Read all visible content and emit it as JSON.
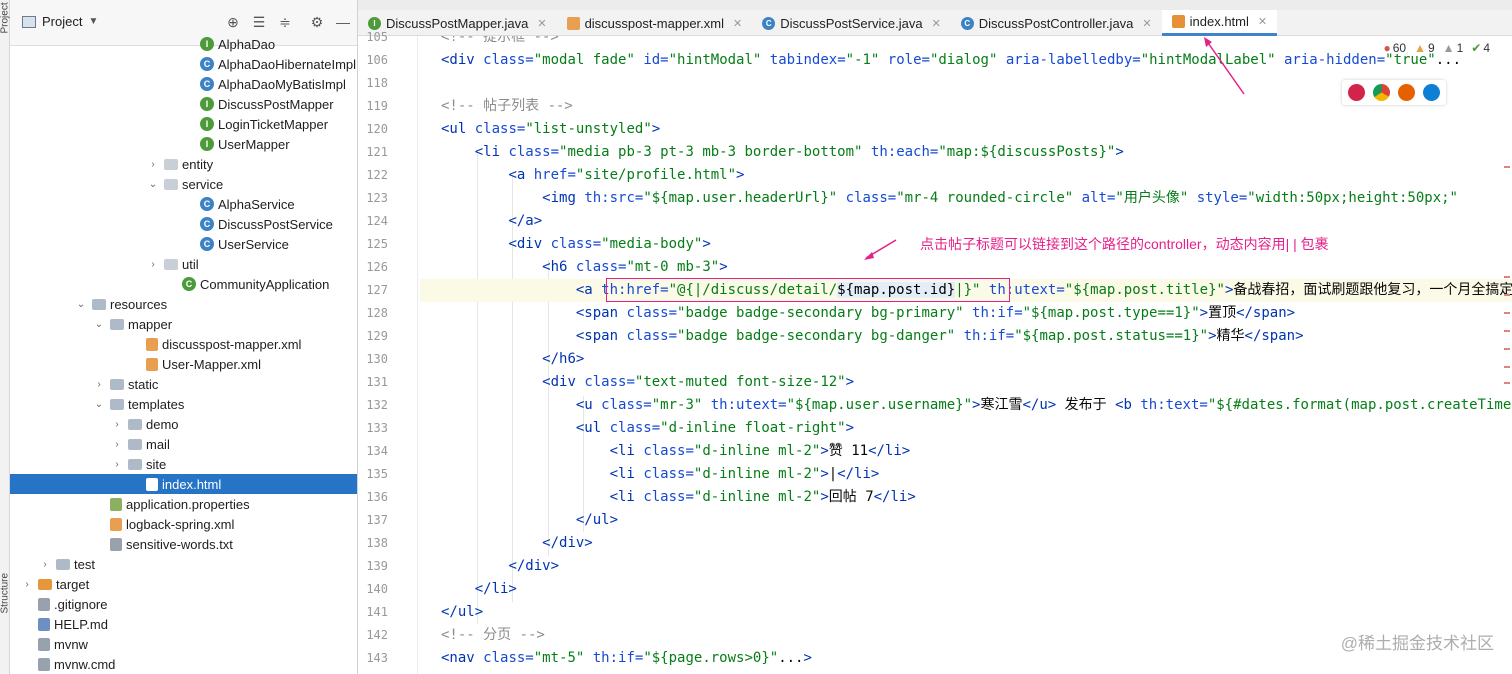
{
  "sidebar": {
    "strip_top": "Project",
    "strip_bottom": "Structure",
    "title": "Project",
    "icons": [
      "crosshair-icon",
      "expand-all-icon",
      "collapse-all-icon",
      "gear-icon",
      "minimize-icon"
    ]
  },
  "tree": [
    {
      "label": "AlphaDao",
      "depth": 10,
      "icon": "i",
      "arrow": ""
    },
    {
      "label": "AlphaDaoHibernateImpl",
      "depth": 10,
      "icon": "c",
      "arrow": ""
    },
    {
      "label": "AlphaDaoMyBatisImpl",
      "depth": 10,
      "icon": "c",
      "arrow": ""
    },
    {
      "label": "DiscussPostMapper",
      "depth": 10,
      "icon": "i",
      "arrow": ""
    },
    {
      "label": "LoginTicketMapper",
      "depth": 10,
      "icon": "i",
      "arrow": ""
    },
    {
      "label": "UserMapper",
      "depth": 10,
      "icon": "i",
      "arrow": ""
    },
    {
      "label": "entity",
      "depth": 8,
      "icon": "pkg",
      "arrow": "›"
    },
    {
      "label": "service",
      "depth": 8,
      "icon": "pkg",
      "arrow": "⌄"
    },
    {
      "label": "AlphaService",
      "depth": 10,
      "icon": "c",
      "arrow": ""
    },
    {
      "label": "DiscussPostService",
      "depth": 10,
      "icon": "c",
      "arrow": ""
    },
    {
      "label": "UserService",
      "depth": 10,
      "icon": "c",
      "arrow": ""
    },
    {
      "label": "util",
      "depth": 8,
      "icon": "pkg",
      "arrow": "›"
    },
    {
      "label": "CommunityApplication",
      "depth": 9,
      "icon": "sb",
      "arrow": ""
    },
    {
      "label": "resources",
      "depth": 4,
      "icon": "folder",
      "arrow": "⌄"
    },
    {
      "label": "mapper",
      "depth": 5,
      "icon": "folder",
      "arrow": "⌄"
    },
    {
      "label": "discusspost-mapper.xml",
      "depth": 7,
      "icon": "xml",
      "arrow": ""
    },
    {
      "label": "User-Mapper.xml",
      "depth": 7,
      "icon": "xml",
      "arrow": ""
    },
    {
      "label": "static",
      "depth": 5,
      "icon": "folder",
      "arrow": "›"
    },
    {
      "label": "templates",
      "depth": 5,
      "icon": "folder",
      "arrow": "⌄"
    },
    {
      "label": "demo",
      "depth": 6,
      "icon": "folder",
      "arrow": "›"
    },
    {
      "label": "mail",
      "depth": 6,
      "icon": "folder",
      "arrow": "›"
    },
    {
      "label": "site",
      "depth": 6,
      "icon": "folder",
      "arrow": "›"
    },
    {
      "label": "index.html",
      "depth": 7,
      "icon": "html",
      "arrow": "",
      "selected": true
    },
    {
      "label": "application.properties",
      "depth": 5,
      "icon": "prop",
      "arrow": ""
    },
    {
      "label": "logback-spring.xml",
      "depth": 5,
      "icon": "xml",
      "arrow": ""
    },
    {
      "label": "sensitive-words.txt",
      "depth": 5,
      "icon": "txt",
      "arrow": ""
    },
    {
      "label": "test",
      "depth": 2,
      "icon": "folder",
      "arrow": "›"
    },
    {
      "label": "target",
      "depth": 1,
      "icon": "orange",
      "arrow": "›"
    },
    {
      "label": ".gitignore",
      "depth": 1,
      "icon": "txt",
      "arrow": ""
    },
    {
      "label": "HELP.md",
      "depth": 1,
      "icon": "md",
      "arrow": ""
    },
    {
      "label": "mvnw",
      "depth": 1,
      "icon": "txt",
      "arrow": ""
    },
    {
      "label": "mvnw.cmd",
      "depth": 1,
      "icon": "txt",
      "arrow": ""
    }
  ],
  "tabs": [
    {
      "label": "DiscussPostMapper.java",
      "icon": "i"
    },
    {
      "label": "discusspost-mapper.xml",
      "icon": "x"
    },
    {
      "label": "DiscussPostService.java",
      "icon": "c"
    },
    {
      "label": "DiscussPostController.java",
      "icon": "c"
    },
    {
      "label": "index.html",
      "icon": "h",
      "active": true
    }
  ],
  "inspections": {
    "errors": "60",
    "warnings": "9",
    "weak": "1",
    "ok": "4"
  },
  "line_numbers": [
    "105",
    "106",
    "118",
    "119",
    "120",
    "121",
    "122",
    "123",
    "124",
    "125",
    "126",
    "127",
    "128",
    "129",
    "130",
    "131",
    "132",
    "133",
    "134",
    "135",
    "136",
    "137",
    "138",
    "139",
    "140",
    "141",
    "142",
    "143"
  ],
  "annotation": "点击帖子标题可以链接到这个路径的controller，动态内容用| | 包裹",
  "watermark": "@稀土掘金技术社区",
  "colors": {
    "annotation": "#e6208a",
    "selection": "#2674c5",
    "tag": "#0033b3",
    "string": "#067d17",
    "comment": "#8c8c8c"
  }
}
